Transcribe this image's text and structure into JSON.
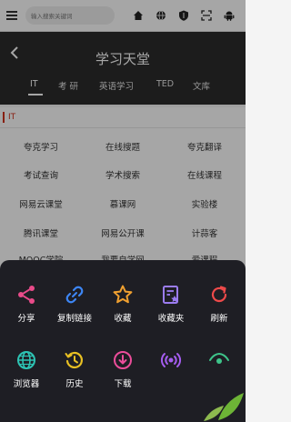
{
  "topbar": {
    "search_placeholder": "输入搜索关键词",
    "icons": [
      "menu-icon",
      "home-icon",
      "globe-icon",
      "shield-icon",
      "scan-icon",
      "android-icon"
    ]
  },
  "header": {
    "title": "学习天堂",
    "tabs": [
      {
        "label": "IT",
        "active": true
      },
      {
        "label": "考 研",
        "active": false
      },
      {
        "label": "英语学习",
        "active": false
      },
      {
        "label": "TED",
        "active": false
      },
      {
        "label": "文库",
        "active": false
      }
    ]
  },
  "section": {
    "title": "IT",
    "links": [
      [
        "夸克学习",
        "在线搜题",
        "夸克翻译"
      ],
      [
        "考试查询",
        "学术搜索",
        "在线课程"
      ],
      [
        "网易云课堂",
        "慕课网",
        "实验楼"
      ],
      [
        "腾讯课堂",
        "网易公开课",
        "计蒜客"
      ],
      [
        "MOOC学院",
        "我要自学网",
        "爱课程"
      ]
    ]
  },
  "sheet": {
    "row1": [
      {
        "label": "分享",
        "icon": "share-icon",
        "color": "#e94b8a"
      },
      {
        "label": "复制链接",
        "icon": "link-icon",
        "color": "#3d86f5"
      },
      {
        "label": "收藏",
        "icon": "star-icon",
        "color": "#f0a030"
      },
      {
        "label": "收藏夹",
        "icon": "favorites-folder-icon",
        "color": "#9b7cf0"
      },
      {
        "label": "刷新",
        "icon": "refresh-icon",
        "color": "#ee4a4a"
      }
    ],
    "row2": [
      {
        "label": "浏览器",
        "icon": "browser-globe-icon",
        "color": "#2dc4b4"
      },
      {
        "label": "历史",
        "icon": "history-icon",
        "color": "#e8c023"
      },
      {
        "label": "下载",
        "icon": "download-icon",
        "color": "#ec4d9a"
      },
      {
        "label": "",
        "icon": "broadcast-icon",
        "color": "#a55df0"
      },
      {
        "label": "",
        "icon": "eye-icon",
        "color": "#3ec48a"
      }
    ]
  }
}
